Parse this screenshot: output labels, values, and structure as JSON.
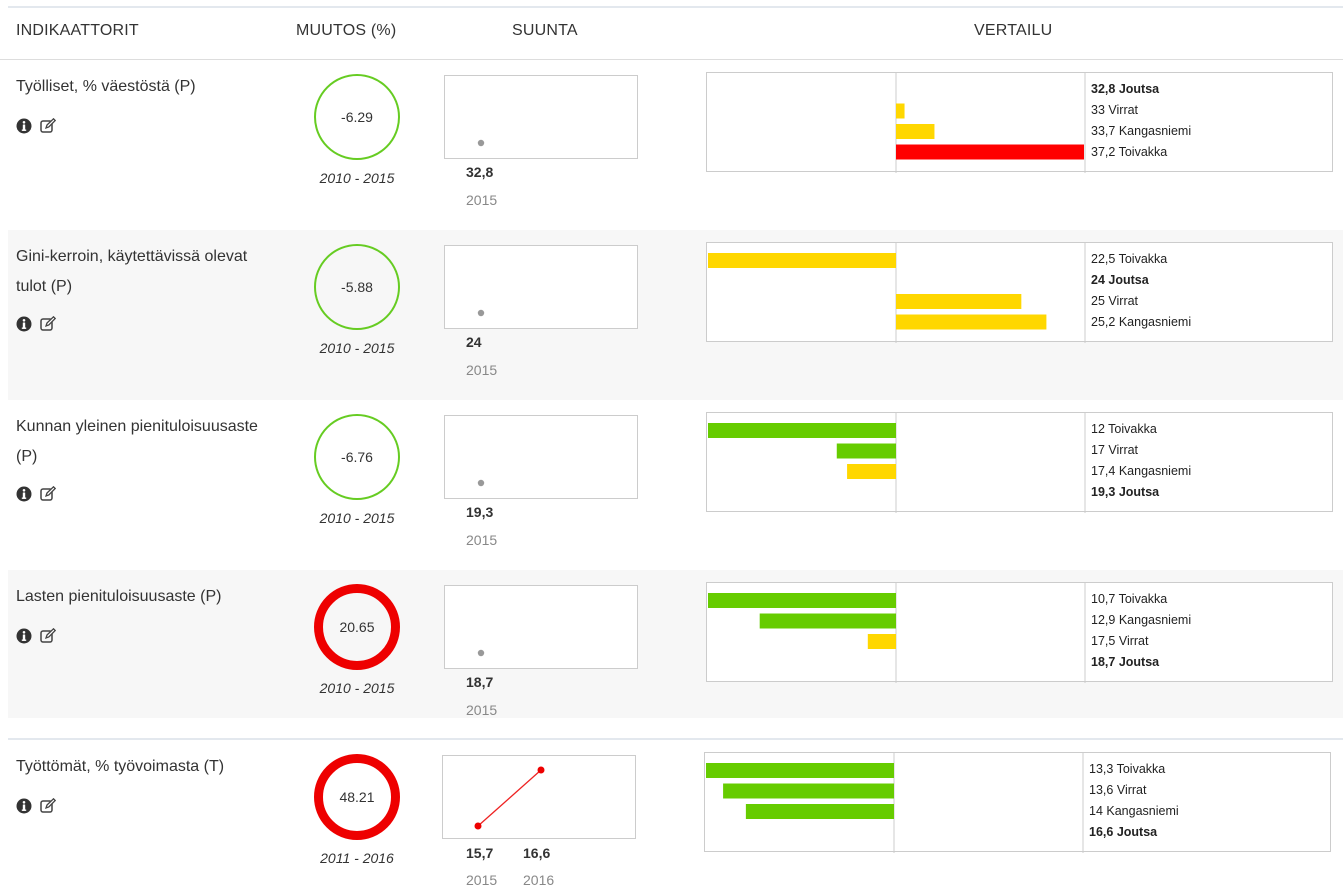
{
  "header": {
    "indicators": "INDIKAATTORIT",
    "change": "MUUTOS (%)",
    "direction": "SUUNTA",
    "comparison": "VERTAILU"
  },
  "colors": {
    "good": "#66cc22",
    "bad": "#ee0000",
    "yellow": "#ffd700",
    "red": "#ff0000",
    "green": "#66cc00"
  },
  "rows": [
    {
      "name": "Työlliset, % väestöstä (P)",
      "change": "-6.29",
      "status": "good",
      "period": "2010 - 2015",
      "trend": {
        "values": [
          "32,8"
        ],
        "years": [
          "2015"
        ]
      },
      "comparison": [
        {
          "value": "32,8",
          "municipality": "Joutsa",
          "bold": true,
          "bar": 0,
          "color": "none"
        },
        {
          "value": "33",
          "municipality": "Virrat",
          "bold": false,
          "bar": 0.2,
          "color": "yellow"
        },
        {
          "value": "33,7",
          "municipality": "Kangasniemi",
          "bold": false,
          "bar": 0.9,
          "color": "yellow"
        },
        {
          "value": "37,2",
          "municipality": "Toivakka",
          "bold": false,
          "bar": 4.4,
          "color": "red"
        }
      ]
    },
    {
      "name": "Gini-kerroin, käytettävissä olevat tulot (P)",
      "change": "-5.88",
      "status": "good",
      "period": "2010 - 2015",
      "trend": {
        "values": [
          "24"
        ],
        "years": [
          "2015"
        ]
      },
      "comparison": [
        {
          "value": "22,5",
          "municipality": "Toivakka",
          "bold": false,
          "bar": -1.5,
          "color": "yellow"
        },
        {
          "value": "24",
          "municipality": "Joutsa",
          "bold": true,
          "bar": 0,
          "color": "none"
        },
        {
          "value": "25",
          "municipality": "Virrat",
          "bold": false,
          "bar": 1.0,
          "color": "yellow"
        },
        {
          "value": "25,2",
          "municipality": "Kangasniemi",
          "bold": false,
          "bar": 1.2,
          "color": "yellow"
        }
      ]
    },
    {
      "name": "Kunnan yleinen pienituloisuusaste (P)",
      "change": "-6.76",
      "status": "good",
      "period": "2010 - 2015",
      "trend": {
        "values": [
          "19,3"
        ],
        "years": [
          "2015"
        ]
      },
      "comparison": [
        {
          "value": "12",
          "municipality": "Toivakka",
          "bold": false,
          "bar": -7.3,
          "color": "green"
        },
        {
          "value": "17",
          "municipality": "Virrat",
          "bold": false,
          "bar": -2.3,
          "color": "green"
        },
        {
          "value": "17,4",
          "municipality": "Kangasniemi",
          "bold": false,
          "bar": -1.9,
          "color": "yellow"
        },
        {
          "value": "19,3",
          "municipality": "Joutsa",
          "bold": true,
          "bar": 0,
          "color": "none"
        }
      ]
    },
    {
      "name": "Lasten pienituloisuusaste (P)",
      "change": "20.65",
      "status": "bad",
      "period": "2010 - 2015",
      "trend": {
        "values": [
          "18,7"
        ],
        "years": [
          "2015"
        ]
      },
      "comparison": [
        {
          "value": "10,7",
          "municipality": "Toivakka",
          "bold": false,
          "bar": -8.0,
          "color": "green"
        },
        {
          "value": "12,9",
          "municipality": "Kangasniemi",
          "bold": false,
          "bar": -5.8,
          "color": "green"
        },
        {
          "value": "17,5",
          "municipality": "Virrat",
          "bold": false,
          "bar": -1.2,
          "color": "yellow"
        },
        {
          "value": "18,7",
          "municipality": "Joutsa",
          "bold": true,
          "bar": 0,
          "color": "none"
        }
      ]
    },
    {
      "name": "Työttömät, % työvoimasta (T)",
      "change": "48.21",
      "status": "bad",
      "period": "2011 - 2016",
      "trend": {
        "values": [
          "15,7",
          "16,6"
        ],
        "years": [
          "2015",
          "2016"
        ]
      },
      "comparison": [
        {
          "value": "13,3",
          "municipality": "Toivakka",
          "bold": false,
          "bar": -3.3,
          "color": "green"
        },
        {
          "value": "13,6",
          "municipality": "Virrat",
          "bold": false,
          "bar": -3.0,
          "color": "green"
        },
        {
          "value": "14",
          "municipality": "Kangasniemi",
          "bold": false,
          "bar": -2.6,
          "color": "green"
        },
        {
          "value": "16,6",
          "municipality": "Joutsa",
          "bold": true,
          "bar": 0,
          "color": "none"
        }
      ]
    }
  ]
}
